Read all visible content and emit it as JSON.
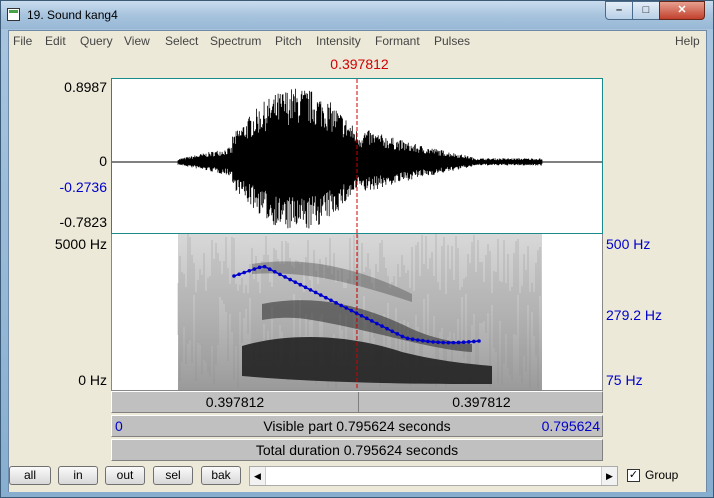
{
  "window": {
    "title": "19. Sound kang4",
    "controls": {
      "minimize": "–",
      "maximize": "□",
      "close": "✕"
    }
  },
  "menu": [
    "File",
    "Edit",
    "Query",
    "View",
    "Select",
    "Spectrum",
    "Pitch",
    "Intensity",
    "Formant",
    "Pulses"
  ],
  "menu_help": "Help",
  "cursor": {
    "time": "0.397812",
    "fraction": 0.5
  },
  "waveform": {
    "max_label": "0.8987",
    "zero_label": "0",
    "marker_label": "-0.2736",
    "min_label": "-0.7823"
  },
  "spectrogram": {
    "freq_top": "5000 Hz",
    "freq_bottom": "0 Hz",
    "pitch_top": "500 Hz",
    "pitch_mid": "279.2 Hz",
    "pitch_bottom": "75 Hz"
  },
  "time_bar": {
    "left": "0.397812",
    "right": "0.397812"
  },
  "visible_bar": {
    "start": "0",
    "text": "Visible part 0.795624 seconds",
    "end": "0.795624"
  },
  "total_bar": {
    "text": "Total duration 0.795624 seconds"
  },
  "buttons": {
    "all": "all",
    "in": "in",
    "out": "out",
    "sel": "sel",
    "bak": "bak"
  },
  "scroll": {
    "left_arrow": "◀",
    "right_arrow": "▶"
  },
  "group": {
    "label": "Group",
    "checked": true,
    "mark": "✓"
  },
  "colors": {
    "cursor": "#d00000",
    "pitch": "#0000cc",
    "frame": "#1a8b8b"
  }
}
